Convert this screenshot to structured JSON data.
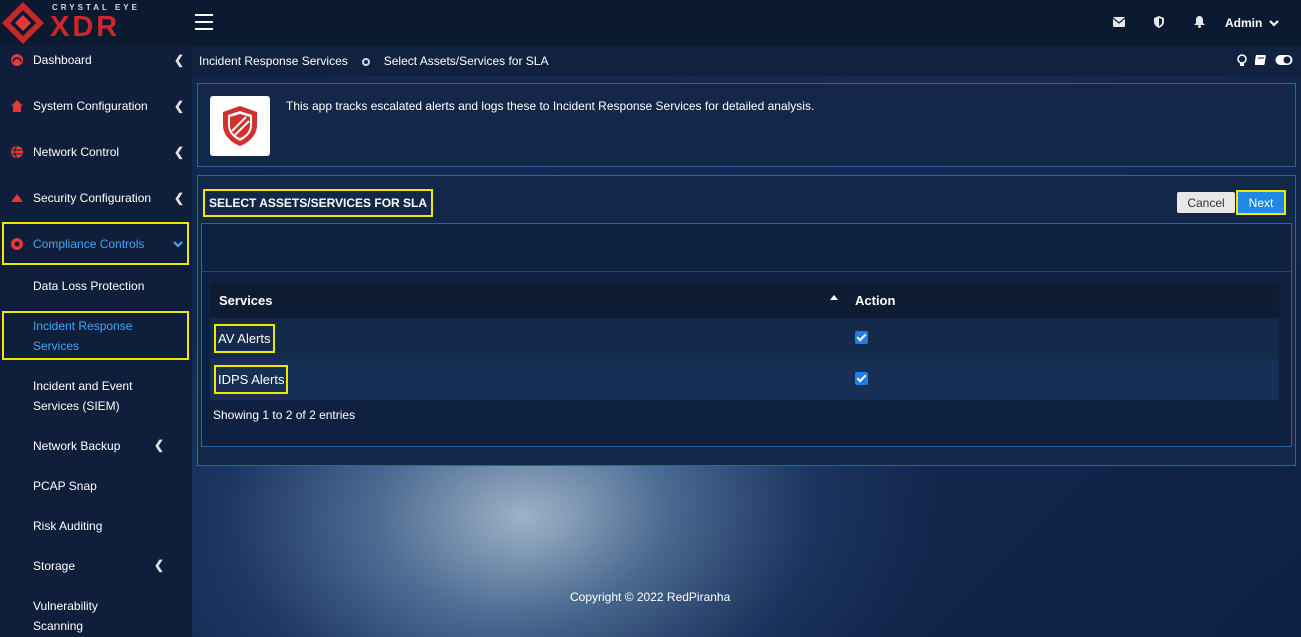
{
  "brand": {
    "tagline": "CRYSTAL EYE",
    "name": "XDR"
  },
  "topbar": {
    "user_label": "Admin"
  },
  "sidebar": {
    "items": [
      {
        "label": "Dashboard"
      },
      {
        "label": "System Configuration"
      },
      {
        "label": "Network Control"
      },
      {
        "label": "Security Configuration"
      },
      {
        "label": "Compliance Controls"
      }
    ],
    "subitems": [
      {
        "label": "Data Loss Protection"
      },
      {
        "label_line1": "Incident Response",
        "label_line2": "Services"
      },
      {
        "label_line1": "Incident and Event",
        "label_line2": "Services (SIEM)"
      },
      {
        "label": "Network Backup"
      },
      {
        "label": "PCAP Snap"
      },
      {
        "label": "Risk Auditing"
      },
      {
        "label": "Storage"
      },
      {
        "label_line1": "Vulnerability",
        "label_line2": "Scanning"
      }
    ]
  },
  "breadcrumb": {
    "parent": "Incident Response Services",
    "current": "Select Assets/Services for SLA"
  },
  "info": {
    "description": "This app tracks escalated alerts and logs these to Incident Response Services for detailed analysis."
  },
  "sla": {
    "title": "SELECT ASSETS/SERVICES FOR SLA",
    "cancel_label": "Cancel",
    "next_label": "Next",
    "columns": {
      "services": "Services",
      "action": "Action"
    },
    "rows": [
      {
        "service": "AV Alerts",
        "checked": true
      },
      {
        "service": "IDPS Alerts",
        "checked": true
      }
    ],
    "showing": "Showing 1 to 2 of 2 entries"
  },
  "footer": {
    "copyright": "Copyright © 2022 RedPiranha"
  },
  "colors": {
    "accent": "#1e88e5",
    "highlight": "#f3e600",
    "brand_red": "#d0262b"
  }
}
